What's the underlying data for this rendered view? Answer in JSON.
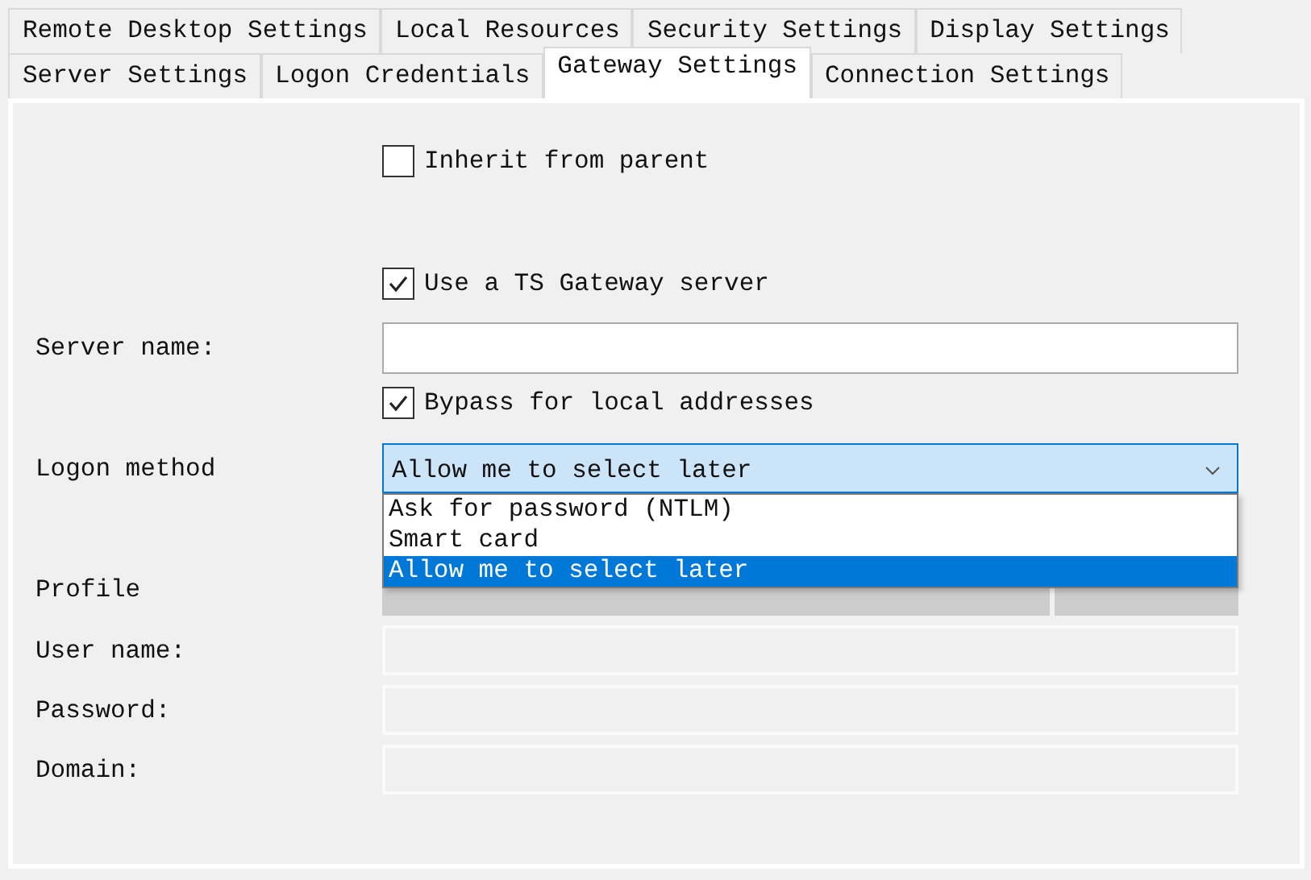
{
  "tab_rows": [
    {
      "tabs": [
        {
          "label": "Remote Desktop Settings",
          "selected": false
        },
        {
          "label": "Local Resources",
          "selected": false
        },
        {
          "label": "Security Settings",
          "selected": false
        },
        {
          "label": "Display Settings",
          "selected": false
        }
      ]
    },
    {
      "tabs": [
        {
          "label": "Server Settings",
          "selected": false
        },
        {
          "label": "Logon Credentials",
          "selected": false
        },
        {
          "label": "Gateway Settings",
          "selected": true
        },
        {
          "label": "Connection Settings",
          "selected": false
        }
      ]
    }
  ],
  "inherit_from_parent": {
    "label": "Inherit from parent",
    "checked": false
  },
  "use_ts_gateway": {
    "label": "Use a TS Gateway server",
    "checked": true
  },
  "server_name": {
    "label": "Server name:"
  },
  "bypass_local": {
    "label": "Bypass for local addresses",
    "checked": true
  },
  "logon_method": {
    "label": "Logon method",
    "value": "Allow me to select later",
    "expanded": true,
    "options": [
      {
        "label": "Ask for password (NTLM)",
        "selected": false
      },
      {
        "label": "Smart card",
        "selected": false
      },
      {
        "label": "Allow me to select later",
        "selected": true
      }
    ]
  },
  "profile": {
    "label": "Profile",
    "disabled": true
  },
  "credentials": [
    {
      "label": "User name:",
      "disabled": true
    },
    {
      "label": "Password:",
      "disabled": true
    },
    {
      "label": "Domain:",
      "disabled": true
    }
  ]
}
